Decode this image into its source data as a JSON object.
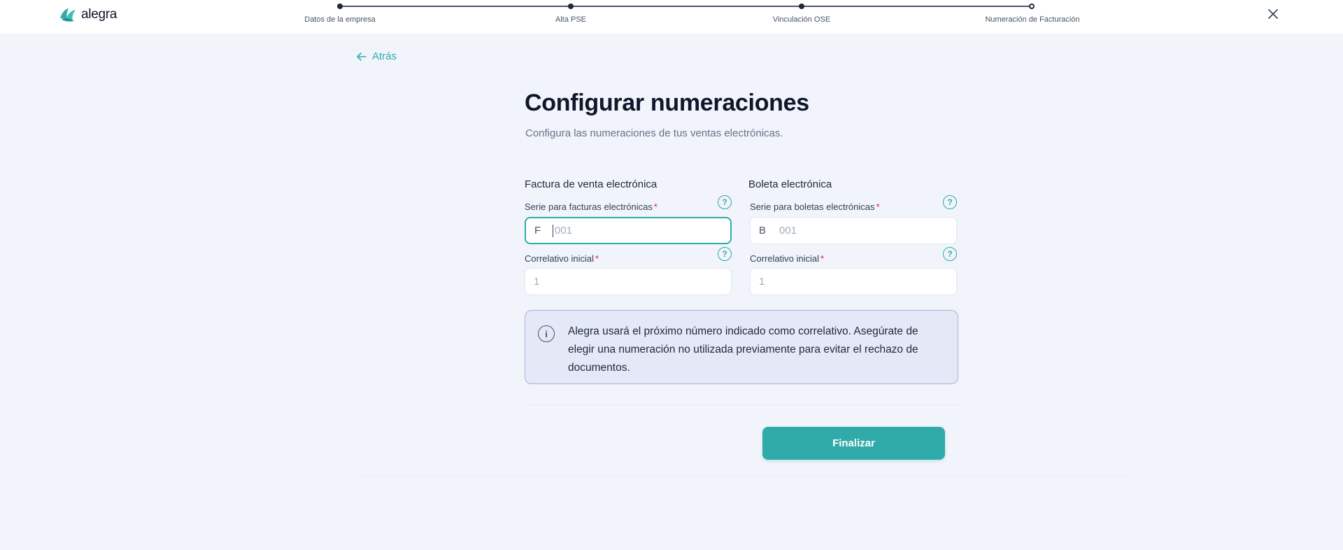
{
  "brand": {
    "name": "alegra",
    "accent": "#30aba9",
    "logo_icon": "alegra-leaf-icon"
  },
  "stepper": {
    "steps": [
      {
        "label": "Datos de la empresa",
        "status": "done"
      },
      {
        "label": "Alta PSE",
        "status": "done"
      },
      {
        "label": "Vinculación OSE",
        "status": "done"
      },
      {
        "label": "Numeración de Facturación",
        "status": "current"
      }
    ]
  },
  "header": {
    "close_icon": "close-icon"
  },
  "back": {
    "label": "Atrás",
    "icon": "arrow-left-icon"
  },
  "page": {
    "title": "Configurar numeraciones",
    "subtitle": "Configura las numeraciones de tus ventas electrónicas."
  },
  "factura": {
    "section_title": "Factura de venta electrónica",
    "serie_label": "Serie para facturas electrónicas",
    "serie_prefix": "F",
    "serie_placeholder": "001",
    "correlativo_label": "Correlativo inicial",
    "correlativo_placeholder": "1"
  },
  "boleta": {
    "section_title": "Boleta electrónica",
    "serie_label": "Serie para boletas electrónicas",
    "serie_prefix": "B",
    "serie_placeholder": "001",
    "correlativo_label": "Correlativo inicial",
    "correlativo_placeholder": "1"
  },
  "required_mark": "*",
  "help_glyph": "?",
  "info": {
    "icon": "info-icon",
    "glyph": "i",
    "text": "Alegra usará el próximo número indicado como correlativo. Asegúrate de elegir una numeración no utilizada previamente para evitar el rechazo de documentos."
  },
  "actions": {
    "finish_label": "Finalizar"
  }
}
